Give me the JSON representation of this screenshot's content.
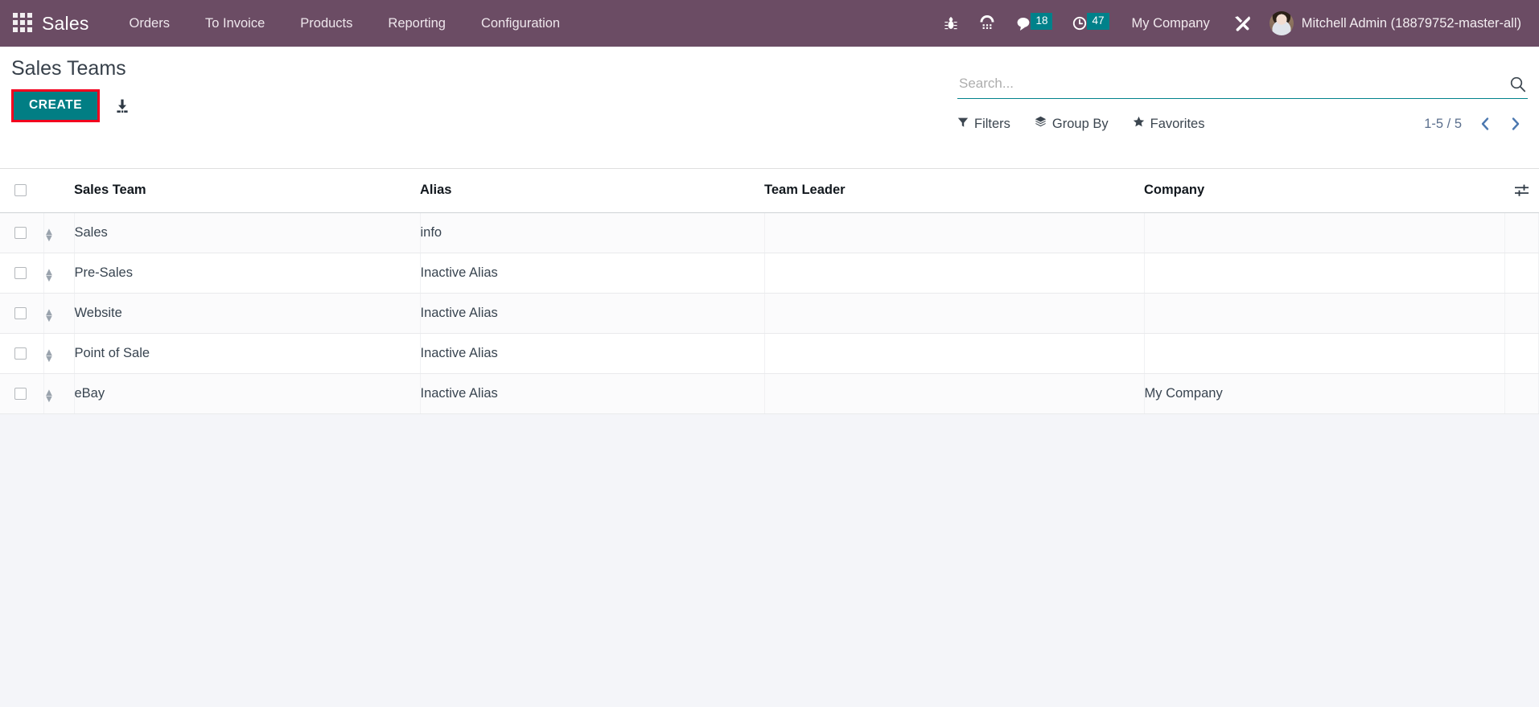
{
  "navbar": {
    "apps_icon": "apps-grid-icon",
    "brand": "Sales",
    "menu_items": [
      {
        "label": "Orders"
      },
      {
        "label": "To Invoice"
      },
      {
        "label": "Products"
      },
      {
        "label": "Reporting"
      },
      {
        "label": "Configuration"
      }
    ],
    "systray": {
      "bug_icon": "bug-icon",
      "phone_icon": "phone-dialpad-icon",
      "messages_icon": "chat-bubble-icon",
      "messages_count": "18",
      "activities_icon": "clock-icon",
      "activities_count": "47",
      "company": "My Company",
      "tools_icon": "tools-icon",
      "avatar_icon": "user-avatar",
      "user": "Mitchell Admin (18879752-master-all)"
    },
    "colors": {
      "background": "#6b4c64",
      "badge": "#00818a",
      "text": "#ffffff"
    }
  },
  "control_panel": {
    "title": "Sales Teams",
    "create_label": "CREATE",
    "create_color": "#017e84",
    "create_highlight_color": "#f2001e",
    "import_icon": "import-download-icon",
    "search": {
      "placeholder": "Search...",
      "value": "",
      "icon": "search-icon",
      "underline_color": "#00828c"
    },
    "facets": [
      {
        "label": "Filters",
        "icon": "filter-funnel-icon"
      },
      {
        "label": "Group By",
        "icon": "layers-icon"
      },
      {
        "label": "Favorites",
        "icon": "star-icon"
      }
    ],
    "pager": {
      "value": "1-5 / 5",
      "prev_icon": "chevron-left-icon",
      "next_icon": "chevron-right-icon"
    }
  },
  "list": {
    "select_all_icon": "checkbox",
    "optional_columns_icon": "column-options-icon",
    "columns": [
      {
        "key": "team",
        "label": "Sales Team"
      },
      {
        "key": "alias",
        "label": "Alias"
      },
      {
        "key": "leader",
        "label": "Team Leader"
      },
      {
        "key": "company",
        "label": "Company"
      }
    ],
    "rows": [
      {
        "team": "Sales",
        "alias": "info",
        "leader": "",
        "company": ""
      },
      {
        "team": "Pre-Sales",
        "alias": "Inactive Alias",
        "leader": "",
        "company": ""
      },
      {
        "team": "Website",
        "alias": "Inactive Alias",
        "leader": "",
        "company": ""
      },
      {
        "team": "Point of Sale",
        "alias": "Inactive Alias",
        "leader": "",
        "company": ""
      },
      {
        "team": "eBay",
        "alias": "Inactive Alias",
        "leader": "",
        "company": "My Company"
      }
    ]
  },
  "page": {
    "background": "#f4f5f9"
  }
}
